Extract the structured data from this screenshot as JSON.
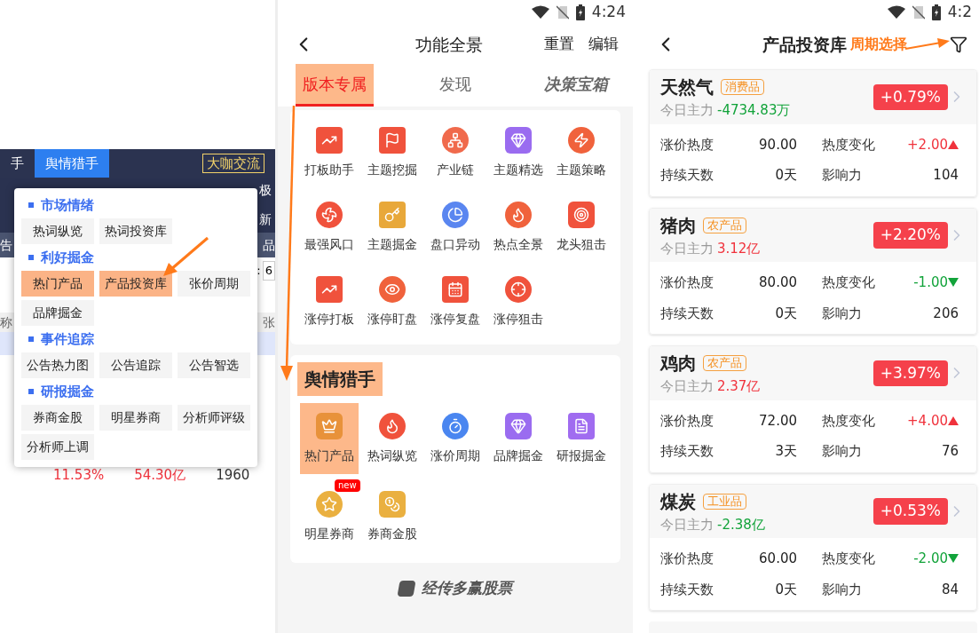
{
  "left": {
    "nav_tabs": [
      {
        "label": "手",
        "selected": false
      },
      {
        "label": "舆情猎手",
        "selected": true
      }
    ],
    "nav_button": "大咖交流",
    "strip_right": [
      "极",
      "新"
    ],
    "row_left": "告",
    "row_right": "品",
    "input_label": ":",
    "input_value": "6",
    "header_left": "称",
    "header_right": "张",
    "row_values": [
      {
        "text": "11.53%",
        "up": true
      },
      {
        "text": "54.30亿",
        "up": true
      },
      {
        "text": "1960",
        "up": false
      }
    ],
    "menu": {
      "sections": [
        {
          "title": "市场情绪",
          "items": [
            {
              "label": "热词纵览",
              "highlighted": false
            },
            {
              "label": "热词投资库",
              "highlighted": false
            }
          ]
        },
        {
          "title": "利好掘金",
          "items": [
            {
              "label": "热门产品",
              "highlighted": true
            },
            {
              "label": "产品投资库",
              "highlighted": true
            },
            {
              "label": "张价周期",
              "highlighted": false
            },
            {
              "label": "品牌掘金",
              "highlighted": false
            }
          ]
        },
        {
          "title": "事件追踪",
          "items": [
            {
              "label": "公告热力图",
              "highlighted": false
            },
            {
              "label": "公告追踪",
              "highlighted": false
            },
            {
              "label": "公告智选",
              "highlighted": false
            }
          ]
        },
        {
          "title": "研报掘金",
          "items": [
            {
              "label": "券商金股",
              "highlighted": false
            },
            {
              "label": "明星券商",
              "highlighted": false
            },
            {
              "label": "分析师评级",
              "highlighted": false
            },
            {
              "label": "分析师上调",
              "highlighted": false
            }
          ]
        }
      ]
    }
  },
  "middle": {
    "status_time": "4:24",
    "title": "功能全景",
    "actions": [
      "重置",
      "编辑"
    ],
    "tabs": [
      {
        "label": "版本专属",
        "selected": true,
        "highlighted": true,
        "kind": "text"
      },
      {
        "label": "发现",
        "selected": false,
        "highlighted": false,
        "kind": "text"
      },
      {
        "label": "决策宝箱",
        "selected": false,
        "highlighted": false,
        "kind": "logo"
      }
    ],
    "groups": [
      {
        "items": [
          {
            "label": "打板助手"
          },
          {
            "label": "主题挖掘"
          },
          {
            "label": "产业链"
          },
          {
            "label": "主题精选"
          },
          {
            "label": "主题策略"
          },
          {
            "label": "最强风口"
          },
          {
            "label": "主题掘金"
          },
          {
            "label": "盘口异动"
          },
          {
            "label": "热点全景"
          },
          {
            "label": "龙头狙击"
          },
          {
            "label": "涨停打板"
          },
          {
            "label": "涨停盯盘"
          },
          {
            "label": "涨停复盘"
          },
          {
            "label": "涨停狙击"
          }
        ]
      },
      {
        "title": "舆情猎手",
        "title_highlighted": true,
        "items": [
          {
            "label": "热门产品",
            "highlighted": true
          },
          {
            "label": "热词纵览",
            "highlighted": false
          },
          {
            "label": "涨价周期",
            "highlighted": false
          },
          {
            "label": "品牌掘金",
            "highlighted": false
          },
          {
            "label": "研报掘金",
            "highlighted": false
          },
          {
            "label": "明星券商",
            "highlighted": false,
            "badge": "new"
          },
          {
            "label": "券商金股",
            "highlighted": false
          }
        ]
      }
    ],
    "footer_logo": "经传多赢股票"
  },
  "right": {
    "status_time": "4:2",
    "title": "产品投资库",
    "annotation": "周期选择",
    "cards": [
      {
        "name": "天然气",
        "tag": "消费品",
        "main_label": "今日主力",
        "main_value": "-4734.83万",
        "main_up": false,
        "change": "+0.79%",
        "stats": [
          {
            "label": "涨价热度",
            "value": "90.00"
          },
          {
            "label": "热度变化",
            "value": "+2.00",
            "up": true
          },
          {
            "label": "持续天数",
            "value": "0天"
          },
          {
            "label": "影响力",
            "value": "104"
          }
        ]
      },
      {
        "name": "猪肉",
        "tag": "农产品",
        "main_label": "今日主力",
        "main_value": "3.12亿",
        "main_up": true,
        "change": "+2.20%",
        "stats": [
          {
            "label": "涨价热度",
            "value": "80.00"
          },
          {
            "label": "热度变化",
            "value": "-1.00",
            "up": false
          },
          {
            "label": "持续天数",
            "value": "0天"
          },
          {
            "label": "影响力",
            "value": "206"
          }
        ]
      },
      {
        "name": "鸡肉",
        "tag": "农产品",
        "main_label": "今日主力",
        "main_value": "2.37亿",
        "main_up": true,
        "change": "+3.97%",
        "stats": [
          {
            "label": "涨价热度",
            "value": "72.00"
          },
          {
            "label": "热度变化",
            "value": "+4.00",
            "up": true
          },
          {
            "label": "持续天数",
            "value": "3天"
          },
          {
            "label": "影响力",
            "value": "76"
          }
        ]
      },
      {
        "name": "煤炭",
        "tag": "工业品",
        "main_label": "今日主力",
        "main_value": "-2.38亿",
        "main_up": false,
        "change": "+0.53%",
        "stats": [
          {
            "label": "涨价热度",
            "value": "60.00"
          },
          {
            "label": "热度变化",
            "value": "-2.00",
            "up": false
          },
          {
            "label": "持续天数",
            "value": "0天"
          },
          {
            "label": "影响力",
            "value": "84"
          }
        ]
      }
    ]
  }
}
